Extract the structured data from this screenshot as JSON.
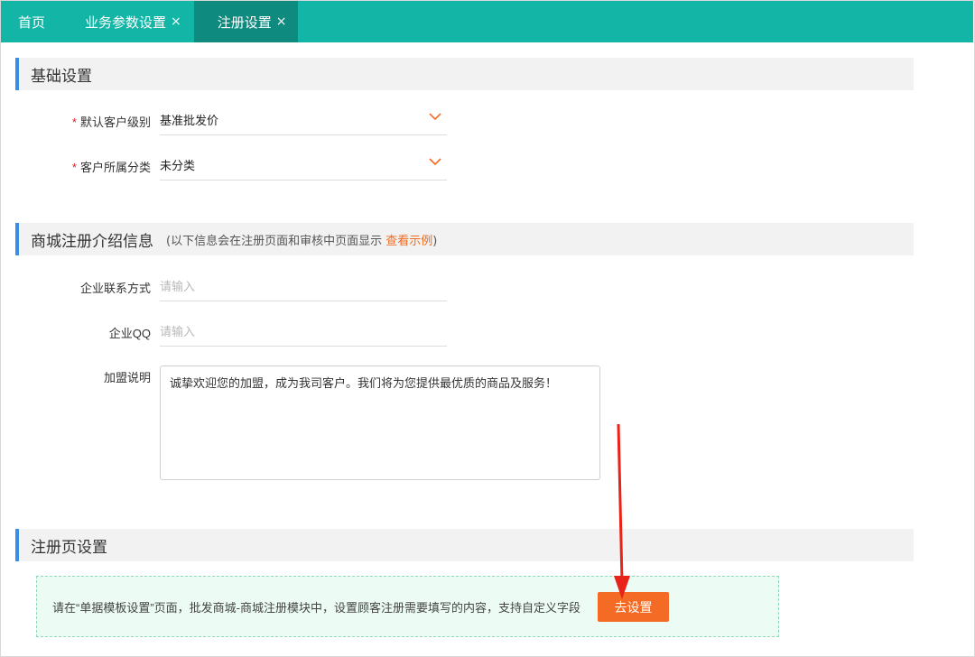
{
  "tabs": [
    {
      "label": "首页",
      "closable": false,
      "active": false
    },
    {
      "label": "业务参数设置",
      "closable": true,
      "active": false
    },
    {
      "label": "注册设置",
      "closable": true,
      "active": true
    }
  ],
  "close_glyph": "×",
  "section_basic": {
    "title": "基础设置",
    "fields": [
      {
        "label": "默认客户级别",
        "required": true,
        "value": "基准批发价"
      },
      {
        "label": "客户所属分类",
        "required": true,
        "value": "未分类"
      }
    ]
  },
  "section_intro": {
    "title": "商城注册介绍信息",
    "note_prefix": "(以下信息会在注册页面和审核中页面显示 ",
    "note_link": "查看示例",
    "note_suffix": ")",
    "contact": {
      "label": "企业联系方式",
      "placeholder": "请输入"
    },
    "qq": {
      "label": "企业QQ",
      "placeholder": "请输入"
    },
    "join": {
      "label": "加盟说明",
      "value": "诚挚欢迎您的加盟，成为我司客户。我们将为您提供最优质的商品及服务！"
    }
  },
  "section_register": {
    "title": "注册页设置",
    "tip": "请在“单据模板设置”页面，批发商城-商城注册模块中，设置顾客注册需要填写的内容，支持自定义字段",
    "button": "去设置"
  },
  "colors": {
    "tabbar": "#13b5a6",
    "tab_active": "#0e8a7f",
    "accent_orange": "#f46b25",
    "section_bar": "#3a8ee6",
    "required": "#e02020",
    "annotation_arrow": "#e8231a"
  },
  "icons": {
    "dropdown": "chevron-down-icon",
    "close": "close-icon"
  }
}
